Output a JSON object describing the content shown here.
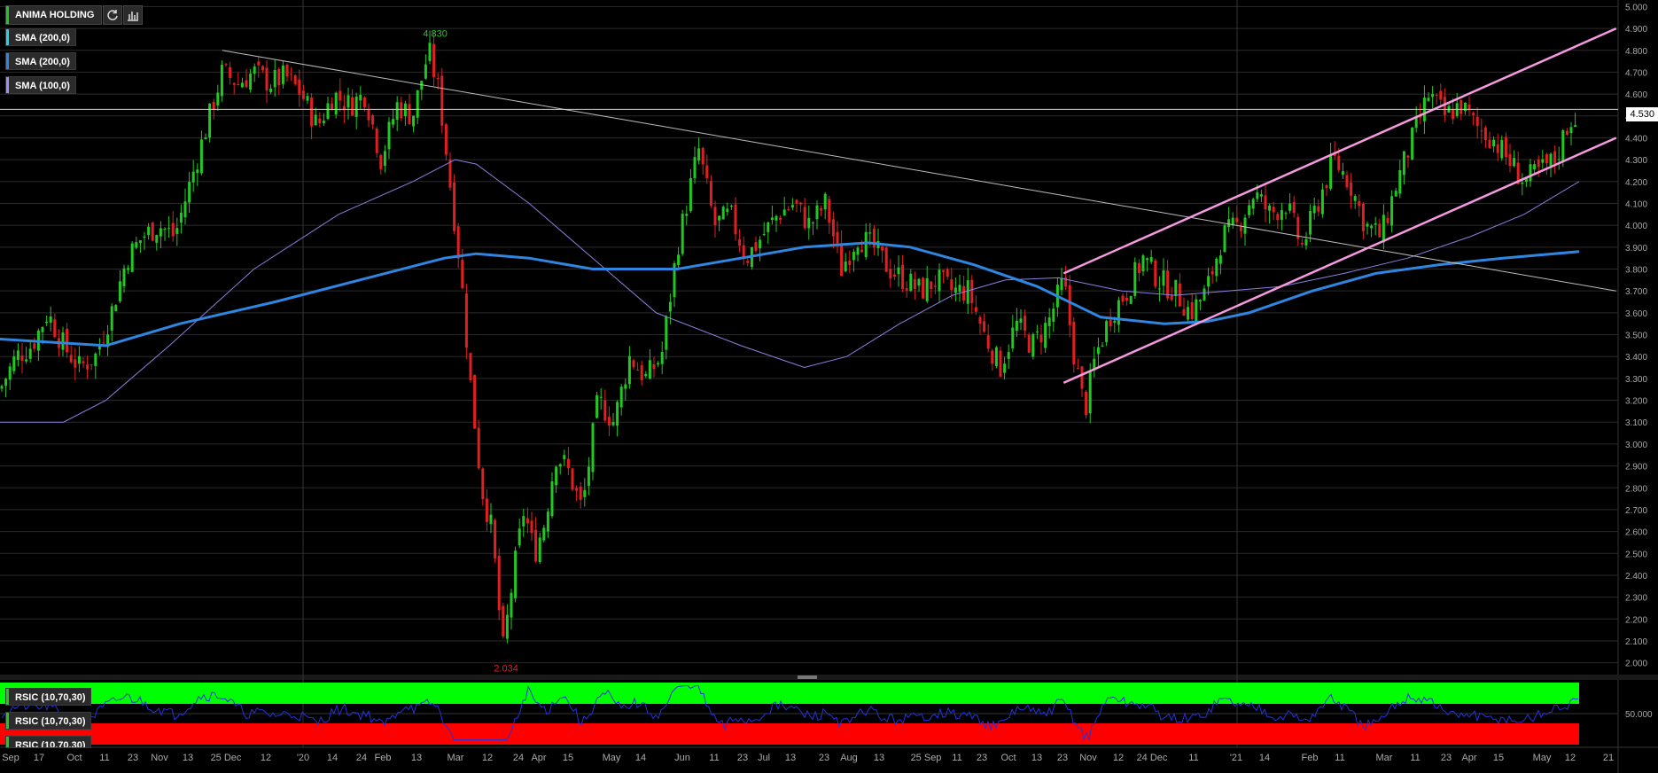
{
  "symbol": "ANIMA HOLDING",
  "indicators": [
    {
      "label": "SMA (200,0)",
      "color": "#22d3ee"
    },
    {
      "label": "SMA (200,0)",
      "color": "#2f86e0"
    },
    {
      "label": "SMA (100,0)",
      "color": "#9d8ff0"
    }
  ],
  "rsi_labels": [
    "RSIC (10,70,30)",
    "RSIC (10,70,30)",
    "RSIC (10,70,30)"
  ],
  "last_price": "4.530",
  "annotations": {
    "high": "4.830",
    "low": "2.034"
  },
  "rsi_level_label": "50.000",
  "colors": {
    "up": "#22c822",
    "down": "#e02020",
    "sma200": "#2f86e0",
    "sma100": "#8a80e0",
    "channel": "#f59ae0",
    "trend": "#bdbdbd",
    "rsi_line": "#2233dd",
    "rsi_over": "#00ff00",
    "rsi_under": "#ff0000"
  },
  "chart_data": {
    "type": "candlestick",
    "y_ticks": [
      "5.000",
      "4.900",
      "4.800",
      "4.700",
      "4.600",
      "4.500",
      "4.400",
      "4.300",
      "4.200",
      "4.100",
      "4.000",
      "3.900",
      "3.800",
      "3.700",
      "3.600",
      "3.500",
      "3.400",
      "3.300",
      "3.200",
      "3.100",
      "3.000",
      "2.900",
      "2.800",
      "2.700",
      "2.600",
      "2.500",
      "2.400",
      "2.300",
      "2.200",
      "2.100",
      "2.000"
    ],
    "ylim": [
      1.95,
      5.03
    ],
    "x_ticks": [
      "Sep",
      "17",
      "Oct",
      "11",
      "23",
      "Nov",
      "13",
      "25 Dec",
      "12",
      "'20",
      "14",
      "24",
      "Feb",
      "13",
      "Mar",
      "12",
      "24",
      "Apr",
      "15",
      "May",
      "14",
      "Jun",
      "11",
      "23",
      "Jul",
      "13",
      "23",
      "Aug",
      "13",
      "25 Sep",
      "11",
      "23",
      "Oct",
      "13",
      "23",
      "Nov",
      "12",
      "24 Dec",
      "11",
      "'21",
      "14",
      "Feb",
      "11",
      "Mar",
      "11",
      "23",
      "Apr",
      "15",
      "May",
      "12",
      "21"
    ],
    "close_path": [
      [
        0,
        3.25
      ],
      [
        15,
        3.4
      ],
      [
        30,
        3.45
      ],
      [
        45,
        3.6
      ],
      [
        60,
        3.45
      ],
      [
        75,
        3.35
      ],
      [
        90,
        3.4
      ],
      [
        105,
        3.6
      ],
      [
        120,
        3.85
      ],
      [
        135,
        3.95
      ],
      [
        150,
        4.0
      ],
      [
        165,
        3.95
      ],
      [
        180,
        4.2
      ],
      [
        195,
        4.45
      ],
      [
        210,
        4.7
      ],
      [
        225,
        4.65
      ],
      [
        240,
        4.7
      ],
      [
        255,
        4.65
      ],
      [
        270,
        4.68
      ],
      [
        285,
        4.6
      ],
      [
        300,
        4.45
      ],
      [
        315,
        4.6
      ],
      [
        330,
        4.55
      ],
      [
        345,
        4.6
      ],
      [
        360,
        4.3
      ],
      [
        375,
        4.55
      ],
      [
        390,
        4.5
      ],
      [
        405,
        4.8
      ],
      [
        415,
        4.6
      ],
      [
        425,
        4.2
      ],
      [
        435,
        3.8
      ],
      [
        445,
        3.25
      ],
      [
        455,
        2.8
      ],
      [
        465,
        2.6
      ],
      [
        475,
        2.05
      ],
      [
        485,
        2.4
      ],
      [
        495,
        2.7
      ],
      [
        505,
        2.5
      ],
      [
        515,
        2.65
      ],
      [
        525,
        2.95
      ],
      [
        535,
        2.9
      ],
      [
        550,
        2.7
      ],
      [
        565,
        3.2
      ],
      [
        580,
        3.1
      ],
      [
        595,
        3.4
      ],
      [
        610,
        3.3
      ],
      [
        625,
        3.4
      ],
      [
        640,
        3.9
      ],
      [
        660,
        4.35
      ],
      [
        675,
        4.0
      ],
      [
        690,
        4.05
      ],
      [
        705,
        3.85
      ],
      [
        720,
        3.95
      ],
      [
        735,
        4.05
      ],
      [
        750,
        4.1
      ],
      [
        765,
        4.0
      ],
      [
        780,
        4.1
      ],
      [
        795,
        3.8
      ],
      [
        810,
        3.95
      ],
      [
        825,
        3.9
      ],
      [
        840,
        3.8
      ],
      [
        855,
        3.75
      ],
      [
        870,
        3.7
      ],
      [
        885,
        3.75
      ],
      [
        900,
        3.7
      ],
      [
        915,
        3.7
      ],
      [
        930,
        3.5
      ],
      [
        945,
        3.35
      ],
      [
        960,
        3.55
      ],
      [
        975,
        3.45
      ],
      [
        990,
        3.55
      ],
      [
        1005,
        3.75
      ],
      [
        1015,
        3.4
      ],
      [
        1025,
        3.15
      ],
      [
        1035,
        3.4
      ],
      [
        1050,
        3.6
      ],
      [
        1065,
        3.7
      ],
      [
        1080,
        3.85
      ],
      [
        1095,
        3.75
      ],
      [
        1110,
        3.7
      ],
      [
        1125,
        3.6
      ],
      [
        1140,
        3.7
      ],
      [
        1155,
        3.95
      ],
      [
        1170,
        4.0
      ],
      [
        1185,
        4.15
      ],
      [
        1200,
        4.05
      ],
      [
        1215,
        4.1
      ],
      [
        1230,
        3.9
      ],
      [
        1245,
        4.1
      ],
      [
        1260,
        4.3
      ],
      [
        1275,
        4.2
      ],
      [
        1290,
        4.0
      ],
      [
        1305,
        3.95
      ],
      [
        1320,
        4.2
      ],
      [
        1335,
        4.4
      ],
      [
        1350,
        4.6
      ],
      [
        1365,
        4.5
      ],
      [
        1380,
        4.55
      ],
      [
        1395,
        4.45
      ],
      [
        1410,
        4.4
      ],
      [
        1425,
        4.3
      ],
      [
        1440,
        4.2
      ],
      [
        1455,
        4.25
      ],
      [
        1470,
        4.3
      ],
      [
        1480,
        4.45
      ],
      [
        1492,
        4.53
      ]
    ],
    "sma200": [
      [
        0,
        3.48
      ],
      [
        100,
        3.45
      ],
      [
        170,
        3.55
      ],
      [
        260,
        3.65
      ],
      [
        340,
        3.75
      ],
      [
        420,
        3.85
      ],
      [
        450,
        3.87
      ],
      [
        500,
        3.85
      ],
      [
        560,
        3.8
      ],
      [
        640,
        3.8
      ],
      [
        700,
        3.85
      ],
      [
        760,
        3.9
      ],
      [
        820,
        3.92
      ],
      [
        860,
        3.9
      ],
      [
        920,
        3.82
      ],
      [
        980,
        3.72
      ],
      [
        1040,
        3.58
      ],
      [
        1100,
        3.55
      ],
      [
        1140,
        3.56
      ],
      [
        1180,
        3.6
      ],
      [
        1240,
        3.7
      ],
      [
        1300,
        3.78
      ],
      [
        1360,
        3.82
      ],
      [
        1420,
        3.85
      ],
      [
        1492,
        3.88
      ]
    ],
    "sma100": [
      [
        0,
        3.1
      ],
      [
        60,
        3.1
      ],
      [
        100,
        3.2
      ],
      [
        160,
        3.45
      ],
      [
        240,
        3.8
      ],
      [
        320,
        4.05
      ],
      [
        390,
        4.2
      ],
      [
        430,
        4.3
      ],
      [
        450,
        4.28
      ],
      [
        500,
        4.1
      ],
      [
        560,
        3.85
      ],
      [
        620,
        3.6
      ],
      [
        700,
        3.45
      ],
      [
        760,
        3.35
      ],
      [
        800,
        3.4
      ],
      [
        850,
        3.55
      ],
      [
        900,
        3.68
      ],
      [
        950,
        3.75
      ],
      [
        1000,
        3.76
      ],
      [
        1060,
        3.7
      ],
      [
        1110,
        3.68
      ],
      [
        1160,
        3.7
      ],
      [
        1210,
        3.72
      ],
      [
        1270,
        3.78
      ],
      [
        1330,
        3.85
      ],
      [
        1390,
        3.95
      ],
      [
        1440,
        4.05
      ],
      [
        1492,
        4.2
      ]
    ],
    "trendline": [
      [
        210,
        4.8
      ],
      [
        1527,
        3.7
      ]
    ],
    "channel_upper": [
      [
        1005,
        3.78
      ],
      [
        1527,
        4.9
      ]
    ],
    "channel_lower": [
      [
        1005,
        3.28
      ],
      [
        1527,
        4.4
      ]
    ],
    "high_point": {
      "x": 407,
      "y": 4.83
    },
    "low_point": {
      "x": 474,
      "y": 2.034
    }
  }
}
